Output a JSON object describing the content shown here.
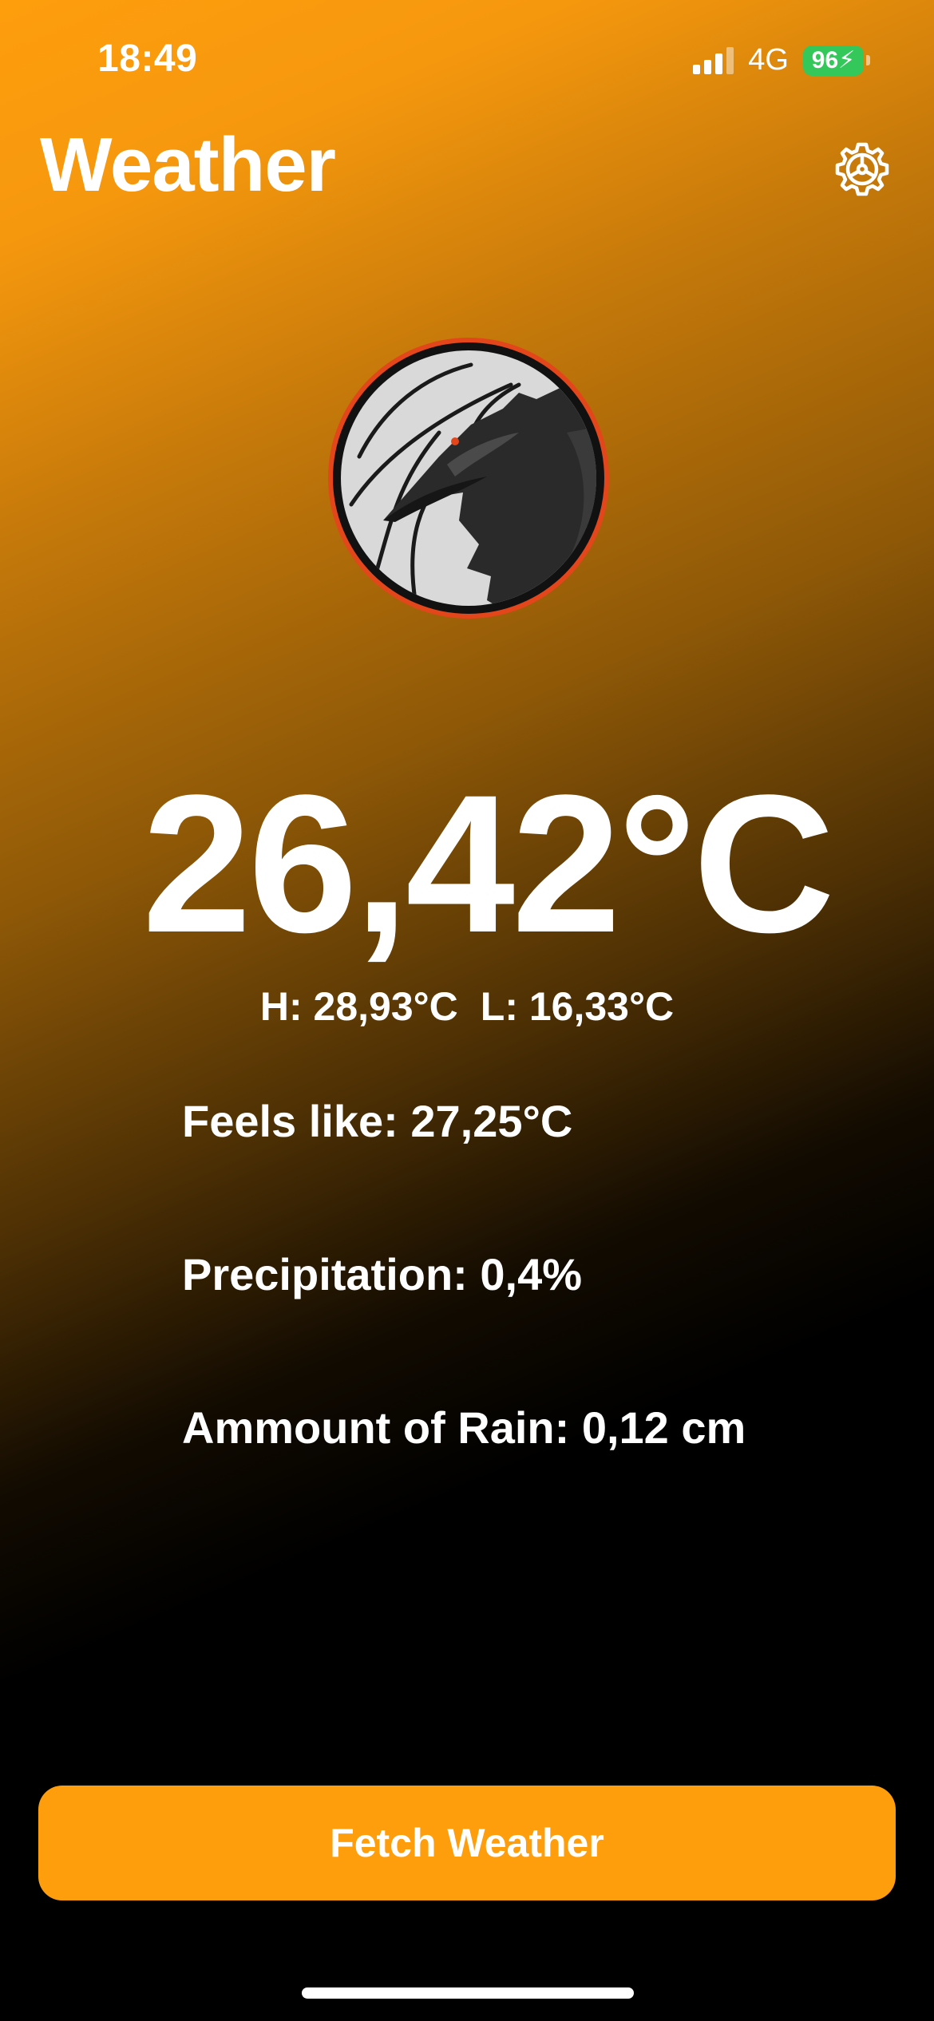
{
  "status_bar": {
    "time": "18:49",
    "network": "4G",
    "battery": "96"
  },
  "header": {
    "title": "Weather",
    "settings_icon": "gear-icon"
  },
  "logo": {
    "icon": "raven-emblem",
    "ring_color": "#E3461B"
  },
  "weather": {
    "temperature": "26,42°C",
    "high": "H: 28,93°C",
    "low": "L: 16,33°C",
    "feels_like": "Feels like: 27,25°C",
    "precipitation": "Precipitation: 0,4%",
    "rain_amount": "Ammount of Rain: 0,12 cm"
  },
  "actions": {
    "fetch_label": "Fetch Weather"
  },
  "colors": {
    "accent": "#FE9E0D",
    "background_bottom": "#000000",
    "battery": "#34C759"
  }
}
